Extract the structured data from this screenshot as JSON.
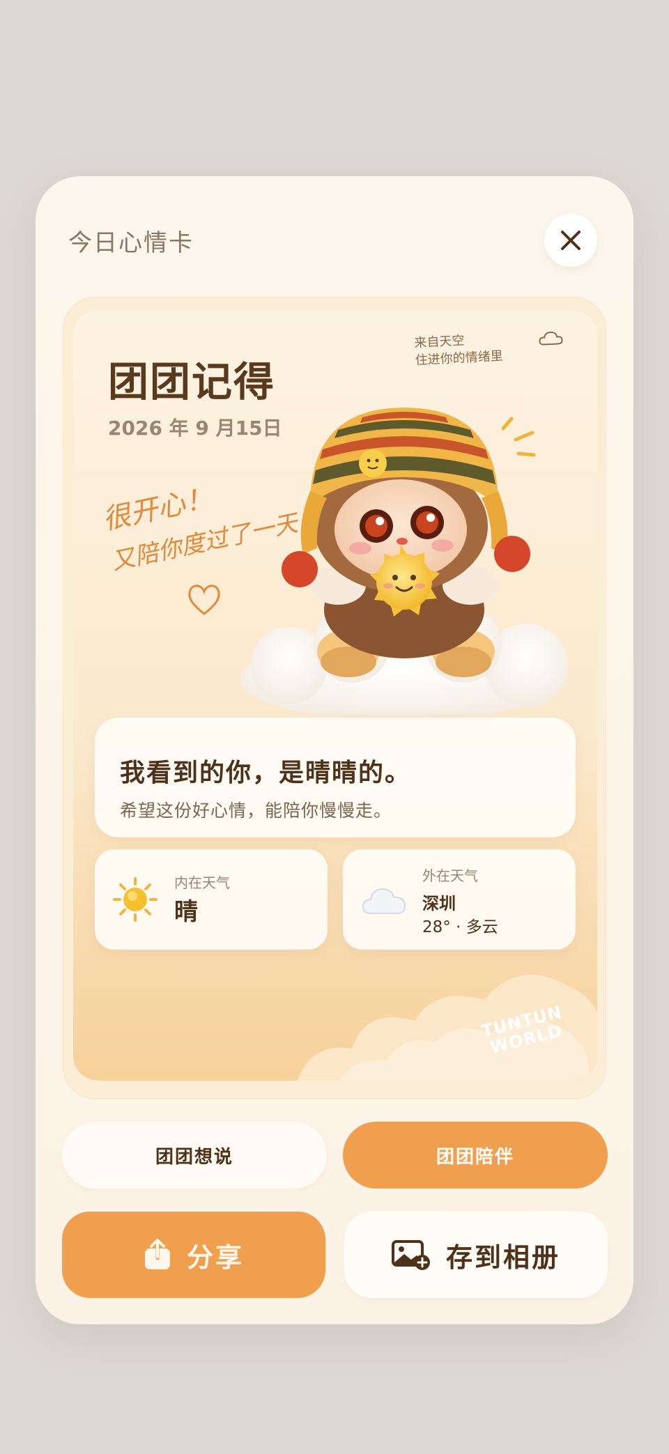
{
  "header": {
    "title": "今日心情卡",
    "close_icon": "close-icon"
  },
  "card": {
    "title": "团团记得",
    "date": "2026 年 9 月15日",
    "source_note_line1": "来自天空",
    "source_note_line2": "住进你的情绪里",
    "handwriting_line1": "很开心！",
    "handwriting_line2": "又陪你度过了一天",
    "message_main": "我看到的你，是晴晴的。",
    "message_sub": "希望这份好心情，能陪你慢慢走。",
    "brand_line1": "TUNTUN",
    "brand_line2": "WORLD"
  },
  "weather": {
    "inner": {
      "label": "内在天气",
      "value": "晴",
      "icon": "sun-icon"
    },
    "outer": {
      "label": "外在天气",
      "city": "深圳",
      "temp": "28° · 多云",
      "icon": "cloud-icon"
    }
  },
  "pills": {
    "say": "团团想说",
    "accompany": "团团陪伴"
  },
  "actions": {
    "share": "分享",
    "save": "存到相册"
  },
  "colors": {
    "accent": "#ef9f4d",
    "title": "#5a3a1e",
    "background": "#fdf6ec"
  }
}
